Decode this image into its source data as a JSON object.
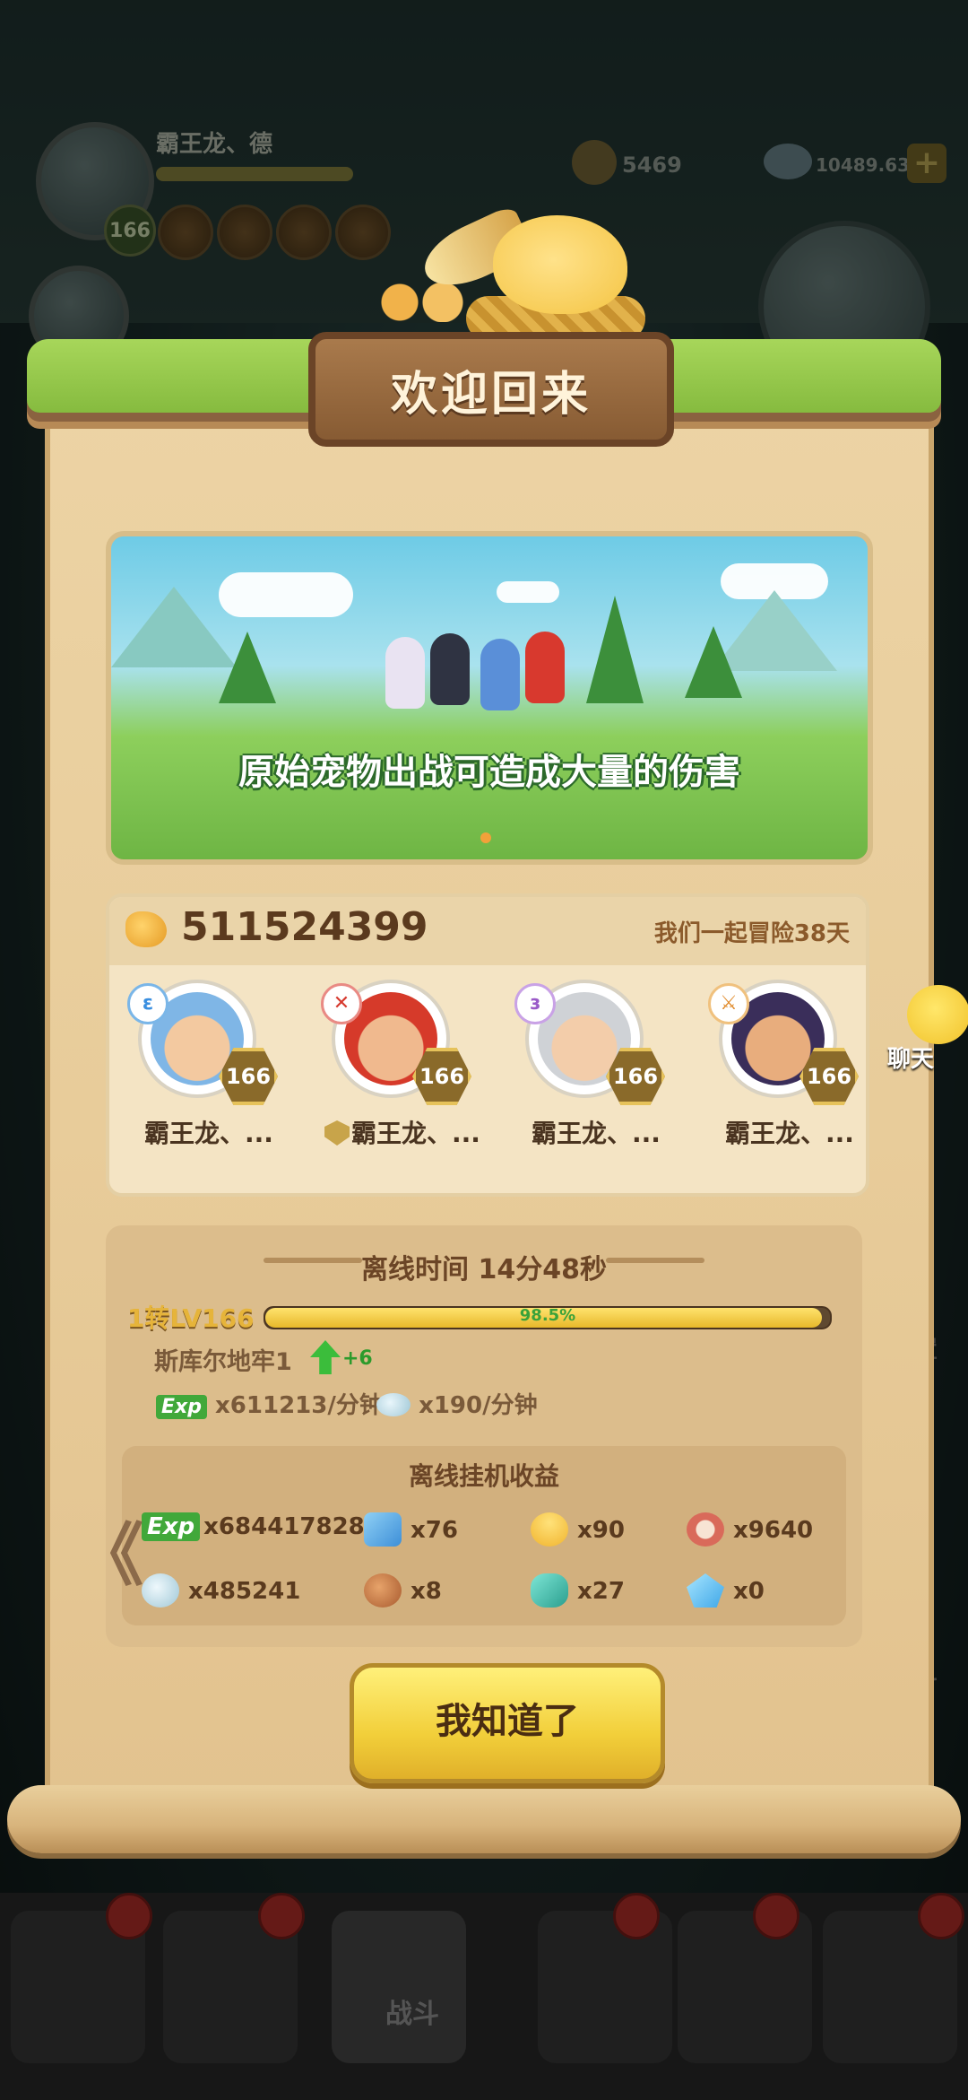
{
  "background": {
    "player_name": "霸王龙、德",
    "player_level": "166",
    "resource_1": "5469",
    "resource_2": "10489.63M",
    "plus": "+",
    "side_labels": [
      "置",
      "斗"
    ]
  },
  "dialog": {
    "title": "欢迎回来",
    "banner_text": "原始宠物出战可造成大量的伤害",
    "power": "511524399",
    "together_days": "我们一起冒险38天",
    "members": [
      {
        "name": "霸王龙、...",
        "level": "166",
        "element": "ε",
        "hair": "#7fb6e6",
        "skin": "#f3c9a0"
      },
      {
        "name": "霸王龙、...",
        "level": "166",
        "element": "✕",
        "hair": "#d63a2a",
        "skin": "#f0b98e"
      },
      {
        "name": "霸王龙、...",
        "level": "166",
        "element": "ɜ",
        "hair": "#cfd2d6",
        "skin": "#f3cdaa"
      },
      {
        "name": "霸王龙、...",
        "level": "166",
        "element": "⚔",
        "hair": "#3a2e5a",
        "skin": "#e8ad7d"
      }
    ],
    "offline": {
      "time_label": "离线时间 14分48秒",
      "level_label": "1转LV166",
      "xp_percent_text": "98.5%",
      "xp_fraction": 0.985,
      "dungeon": "斯库尔地牢1",
      "dungeon_bonus": "+6",
      "exp_tag": "Exp",
      "exp_rate": "x611213/分钟",
      "stone_rate": "x190/分钟",
      "rewards_title": "离线挂机收益",
      "rewards": [
        {
          "icon": "exp-icon",
          "value": "x684417828"
        },
        {
          "icon": "ticket-icon",
          "value": "x76"
        },
        {
          "icon": "candle-icon",
          "value": "x90"
        },
        {
          "icon": "medal-icon",
          "value": "x9640"
        },
        {
          "icon": "stone-icon",
          "value": "x485241"
        },
        {
          "icon": "meat-icon",
          "value": "x8"
        },
        {
          "icon": "gem-icon",
          "value": "x27"
        },
        {
          "icon": "crystal-icon",
          "value": "x0"
        }
      ]
    },
    "ok_button": "我知道了",
    "back_chevron": "《"
  },
  "chat": {
    "label": "聊天"
  },
  "bottom_nav": {
    "battle_label": "战斗"
  }
}
